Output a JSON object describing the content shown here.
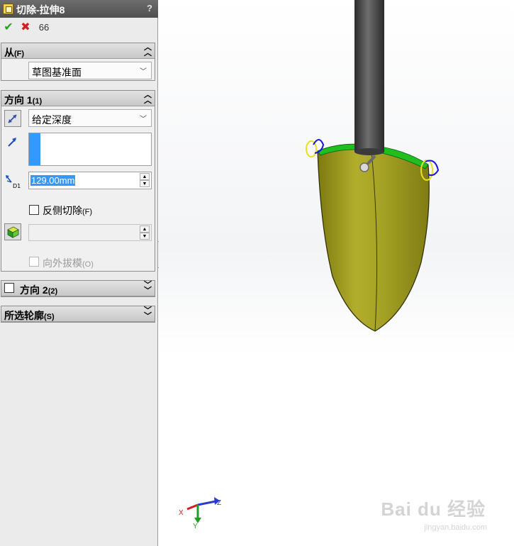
{
  "panel": {
    "title": "切除-拉伸8",
    "help": "?",
    "actions": {
      "ok": "✔",
      "cancel": "✖",
      "preview": "66"
    }
  },
  "from": {
    "header": "从",
    "header_key": "(F)",
    "value": "草图基准面"
  },
  "direction1": {
    "header": "方向 1",
    "header_key": "(1)",
    "end_condition": "给定深度",
    "depth": "129.00mm",
    "flip_label": "反侧切除",
    "flip_key": "(F)",
    "draft_label": "向外拔模",
    "draft_key": "(O)"
  },
  "direction2": {
    "header": "方向 2",
    "header_key": "(2)"
  },
  "contours": {
    "header": "所选轮廓",
    "header_key": "(S)"
  },
  "triad": {
    "x": "X",
    "y": "Y",
    "z": "Z"
  },
  "watermark": {
    "brand": "Bai du 经验",
    "url": "jingyan.baidu.com"
  },
  "colors": {
    "model": "#a6a424",
    "edge_green": "#1fbf1f",
    "sketch_blue": "#1717d9",
    "highlight": "#3399ff"
  }
}
